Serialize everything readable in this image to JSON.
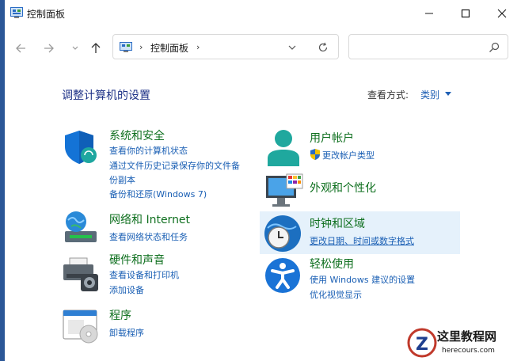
{
  "window": {
    "title": "控制面板"
  },
  "address": {
    "crumb": "控制面板",
    "sep": "›"
  },
  "search": {
    "placeholder": ""
  },
  "main": {
    "heading": "调整计算机的设置",
    "view_by_label": "查看方式:",
    "view_by_value": "类别"
  },
  "categories": {
    "security": {
      "title": "系统和安全",
      "links": [
        "查看你的计算机状态",
        "通过文件历史记录保存你的文件备",
        "份副本",
        "备份和还原(Windows 7)"
      ]
    },
    "network": {
      "title": "网络和 Internet",
      "links": [
        "查看网络状态和任务"
      ]
    },
    "hardware": {
      "title": "硬件和声音",
      "links": [
        "查看设备和打印机",
        "添加设备"
      ]
    },
    "programs": {
      "title": "程序",
      "links": [
        "卸载程序"
      ]
    },
    "users": {
      "title": "用户帐户",
      "links": [
        "更改帐户类型"
      ]
    },
    "appearance": {
      "title": "外观和个性化",
      "links": []
    },
    "clock": {
      "title": "时钟和区域",
      "links": [
        "更改日期、时间或数字格式"
      ]
    },
    "ease": {
      "title": "轻松使用",
      "links": [
        "使用 Windows 建议的设置",
        "优化视觉显示"
      ]
    }
  },
  "watermark": {
    "cn": "这里教程网",
    "en": "herecours.com"
  },
  "colors": {
    "link": "#1a5fb4",
    "title": "#0e6f1e",
    "heading": "#1e3287",
    "highlight": "#e5f1fb"
  }
}
